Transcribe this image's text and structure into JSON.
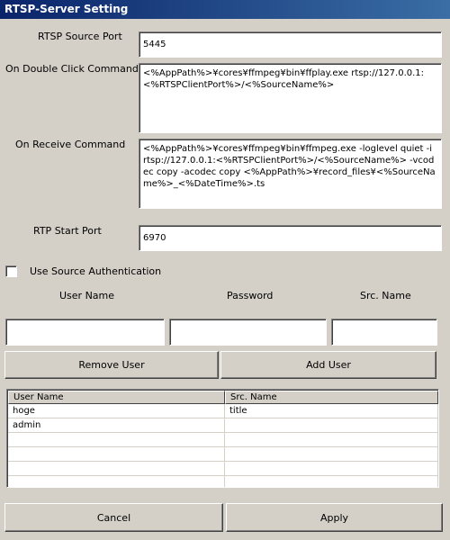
{
  "window": {
    "title": "RTSP-Server Setting"
  },
  "rtsp_port": {
    "label": "RTSP Source Port",
    "value": "5445"
  },
  "double_click": {
    "label": "On Double Click Command",
    "value": "<%AppPath%>¥cores¥ffmpeg¥bin¥ffplay.exe rtsp://127.0.0.1:<%RTSPClientPort%>/<%SourceName%>"
  },
  "on_receive": {
    "label": "On Receive Command",
    "value": "<%AppPath%>¥cores¥ffmpeg¥bin¥ffmpeg.exe -loglevel quiet -i rtsp://127.0.0.1:<%RTSPClientPort%>/<%SourceName%> -vcodec copy -acodec copy <%AppPath%>¥record_files¥<%SourceName%>_<%DateTime%>.ts"
  },
  "rtp_port": {
    "label": "RTP Start Port",
    "value": "6970"
  },
  "auth": {
    "label": "Use Source Authentication",
    "checked": false
  },
  "inputs": {
    "user_name_label": "User Name",
    "password_label": "Password",
    "src_name_label": "Src. Name",
    "user_name_value": "",
    "password_value": "",
    "src_name_value": ""
  },
  "buttons": {
    "remove_user": "Remove User",
    "add_user": "Add User",
    "cancel": "Cancel",
    "apply": "Apply"
  },
  "table": {
    "columns": [
      "User Name",
      "Src. Name"
    ],
    "rows": [
      [
        "hoge",
        "title"
      ],
      [
        "admin",
        ""
      ],
      [
        "",
        ""
      ],
      [
        "",
        ""
      ],
      [
        "",
        ""
      ],
      [
        "",
        ""
      ]
    ]
  }
}
